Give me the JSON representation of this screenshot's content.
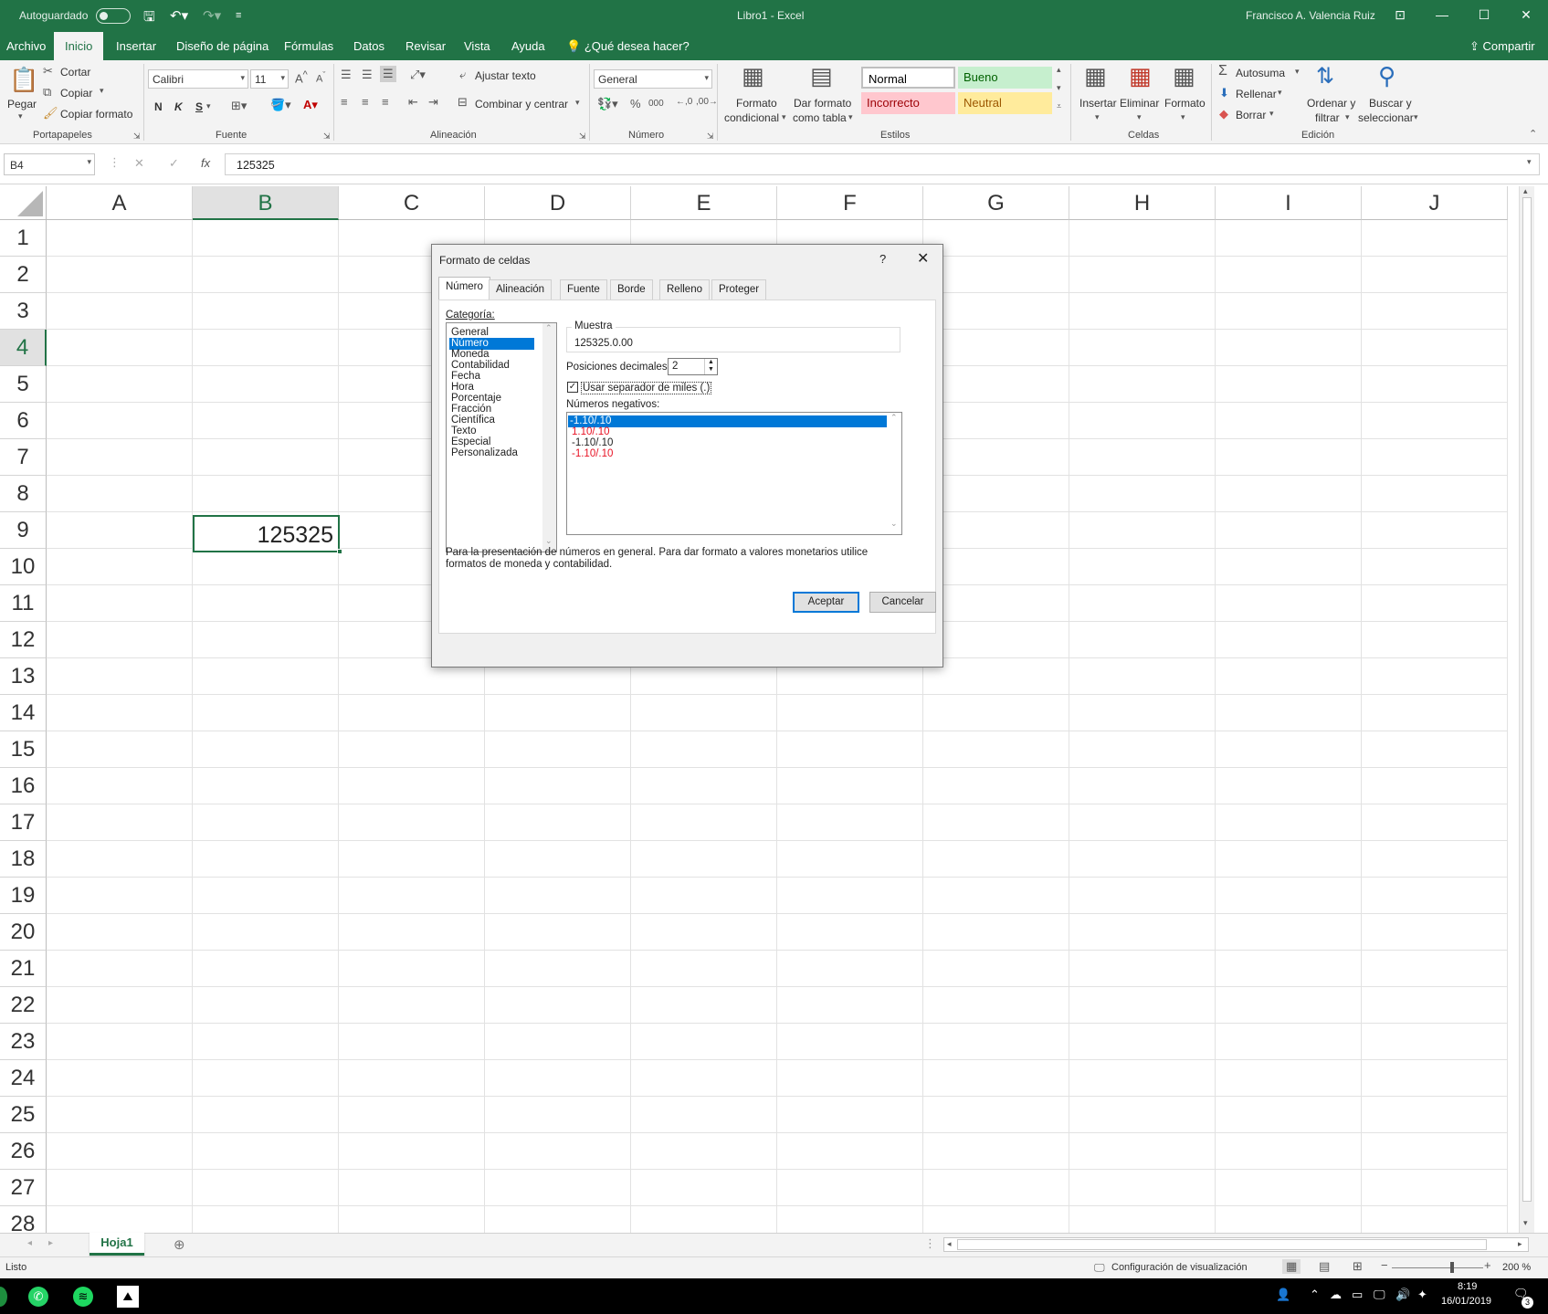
{
  "titlebar": {
    "autosave": "Autoguardado",
    "doc_title": "Libro1  -  Excel",
    "user": "Francisco A. Valencia Ruiz"
  },
  "tabs": [
    "Archivo",
    "Inicio",
    "Insertar",
    "Diseño de página",
    "Fórmulas",
    "Datos",
    "Revisar",
    "Vista",
    "Ayuda"
  ],
  "tell_me": "¿Qué desea hacer?",
  "share": "Compartir",
  "ribbon": {
    "clipboard": {
      "paste": "Pegar",
      "cut": "Cortar",
      "copy": "Copiar",
      "format_painter": "Copiar formato",
      "label": "Portapapeles"
    },
    "font": {
      "name": "Calibri",
      "size": "11",
      "bold": "N",
      "italic": "K",
      "underline": "S",
      "label": "Fuente"
    },
    "alignment": {
      "wrap": "Ajustar texto",
      "merge": "Combinar y centrar",
      "label": "Alineación"
    },
    "number": {
      "format": "General",
      "label": "Número"
    },
    "styles": {
      "cond1": "Formato",
      "cond2": "condicional",
      "table1": "Dar formato",
      "table2": "como tabla",
      "normal": "Normal",
      "good": "Bueno",
      "bad": "Incorrecto",
      "neutral": "Neutral",
      "label": "Estilos"
    },
    "cells": {
      "insert": "Insertar",
      "delete": "Eliminar",
      "format": "Formato",
      "label": "Celdas"
    },
    "editing": {
      "autosum": "Autosuma",
      "fill": "Rellenar",
      "clear": "Borrar",
      "sort1": "Ordenar y",
      "sort2": "filtrar",
      "find1": "Buscar y",
      "find2": "seleccionar",
      "label": "Edición"
    }
  },
  "formula_bar": {
    "name_box": "B4",
    "fx": "fx",
    "value": "125325"
  },
  "columns": [
    "A",
    "B",
    "C",
    "D",
    "E",
    "F",
    "G",
    "H",
    "I",
    "J"
  ],
  "rows": [
    "1",
    "2",
    "3",
    "4",
    "5",
    "6",
    "7",
    "8",
    "9",
    "10",
    "11",
    "12",
    "13",
    "14",
    "15",
    "16",
    "17",
    "18",
    "19",
    "20",
    "21",
    "22",
    "23",
    "24",
    "25",
    "26",
    "27",
    "28"
  ],
  "cell_b4": "125325",
  "dialog": {
    "title": "Formato de celdas",
    "help": "?",
    "tabs": [
      "Número",
      "Alineación",
      "Fuente",
      "Borde",
      "Relleno",
      "Proteger"
    ],
    "category_label": "Categoría:",
    "categories": [
      "General",
      "Número",
      "Moneda",
      "Contabilidad",
      "Fecha",
      "Hora",
      "Porcentaje",
      "Fracción",
      "Científica",
      "Texto",
      "Especial",
      "Personalizada"
    ],
    "sample_label": "Muestra",
    "sample_value": "125325.0.00",
    "decimals_label": "Posiciones decimales:",
    "decimals_value": "2",
    "separator_label": "Usar separador de miles (.)",
    "negatives_label": "Números negativos:",
    "negatives": [
      "-1.10/.10",
      "1.10/.10",
      "-1.10/.10",
      "-1.10/.10"
    ],
    "description": "Para la presentación de números en general. Para dar formato a valores monetarios utilice formatos de moneda y contabilidad.",
    "ok": "Aceptar",
    "cancel": "Cancelar",
    "negative_red": "#e81123"
  },
  "sheet_tab": "Hoja1",
  "status": {
    "ready": "Listo",
    "display": "Configuración de visualización",
    "zoom": "200 %"
  },
  "taskbar": {
    "time": "8:19",
    "date": "16/01/2019",
    "notif": "3"
  },
  "colors": {
    "excel_green": "#217346",
    "selection_blue": "#0078d7"
  }
}
